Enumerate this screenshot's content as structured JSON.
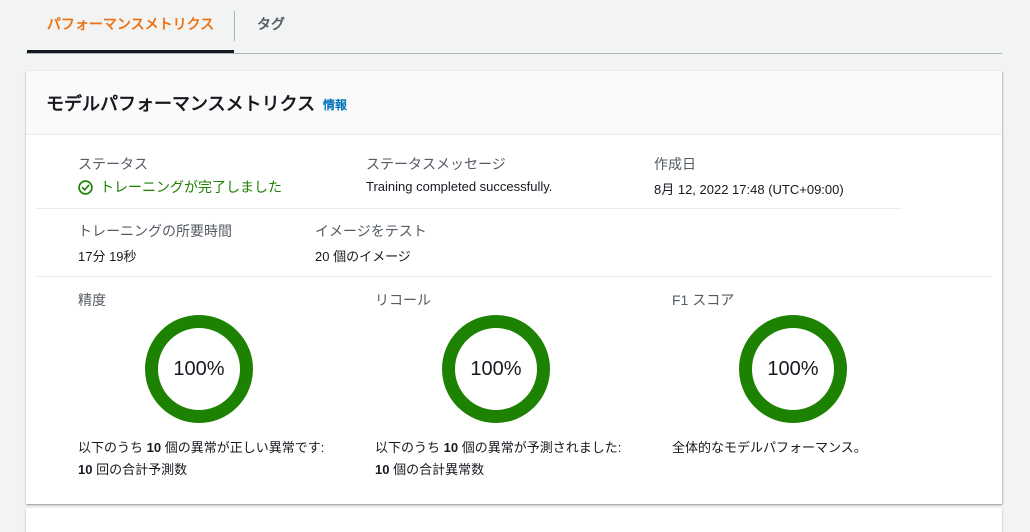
{
  "tabs": [
    {
      "label": "パフォーマンスメトリクス",
      "active": true
    },
    {
      "label": "タグ",
      "active": false
    }
  ],
  "card": {
    "title": "モデルパフォーマンスメトリクス",
    "info_link": "情報"
  },
  "details": {
    "status_label": "ステータス",
    "status_value": "トレーニングが完了しました",
    "status_message_label": "ステータスメッセージ",
    "status_message_value": "Training completed successfully.",
    "created_label": "作成日",
    "created_value": "8月 12, 2022 17:48 (UTC+09:00)",
    "duration_label": "トレーニングの所要時間",
    "duration_value": "17分 19秒",
    "test_images_label": "イメージをテスト",
    "test_images_value": "20 個のイメージ"
  },
  "metrics": [
    {
      "label": "精度",
      "value_text": "100%",
      "value": 1.0,
      "desc_line1_prefix": "以下のうち ",
      "desc_line1_bold": "10",
      "desc_line1_suffix": " 個の異常が正しい異常です:",
      "desc_line2_bold": "10",
      "desc_line2_suffix": " 回の合計予測数"
    },
    {
      "label": "リコール",
      "value_text": "100%",
      "value": 1.0,
      "desc_line1_prefix": "以下のうち ",
      "desc_line1_bold": "10",
      "desc_line1_suffix": " 個の異常が予測されました:",
      "desc_line2_bold": "10",
      "desc_line2_suffix": " 個の合計異常数"
    },
    {
      "label": "F1 スコア",
      "value_text": "100%",
      "value": 1.0,
      "desc_line1_prefix": "全体的なモデルパフォーマンス。",
      "desc_line1_bold": "",
      "desc_line1_suffix": "",
      "desc_line2_bold": "",
      "desc_line2_suffix": ""
    }
  ],
  "colors": {
    "accent": "#ec7211",
    "success": "#1d8102",
    "link": "#0073bb"
  },
  "icons": {
    "status": "check-circle-icon"
  }
}
